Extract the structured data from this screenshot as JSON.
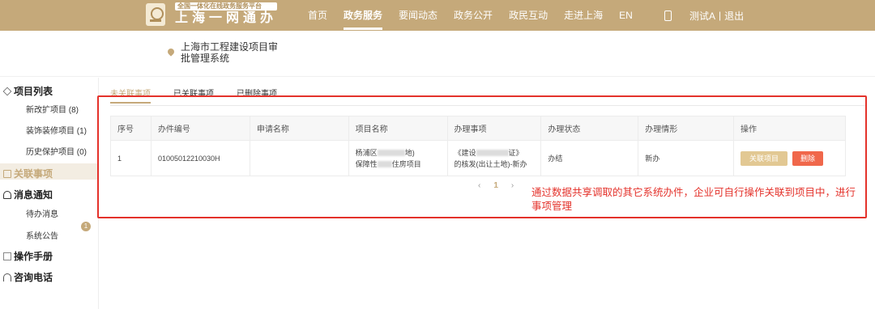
{
  "header": {
    "logo_tag": "全国一体化在线政务服务平台",
    "logo_title": "上海一网通办",
    "nav": [
      "首页",
      "政务服务",
      "要闻动态",
      "政务公开",
      "政民互动",
      "走进上海",
      "EN"
    ],
    "active_nav": "政务服务",
    "user": "测试A",
    "logout": "退出",
    "sep": "|"
  },
  "subheader": {
    "system_title": "上海市工程建设项目审批管理系统"
  },
  "sidebar": {
    "project_list": "项目列表",
    "items": [
      "新改扩项目 (8)",
      "装饰装修项目 (1)",
      "历史保护项目 (0)"
    ],
    "related": "关联事项",
    "messages": "消息通知",
    "msg_items": [
      "待办消息",
      "系统公告"
    ],
    "notice_badge": "1",
    "manual": "操作手册",
    "hotline": "咨询电话"
  },
  "tabs": [
    "未关联事项",
    "已关联事项",
    "已删除事项"
  ],
  "table": {
    "headers": [
      "序号",
      "办件编号",
      "申请名称",
      "项目名称",
      "办理事项",
      "办理状态",
      "办理情形",
      "操作"
    ],
    "rows": [
      {
        "index": "1",
        "case_no": "01005012210030H",
        "apply_name": "",
        "project_line1_a": "杨浦区",
        "project_line1_b": "地)",
        "project_line2_a": "保障性",
        "project_line2_b": "住房项目",
        "matter_line1_a": "《建设",
        "matter_line1_b": "证》",
        "matter_line2": "的核发(出让土地)-新办",
        "status": "办结",
        "situation": "新办",
        "btn_link": "关联项目",
        "btn_delete": "删除"
      }
    ]
  },
  "pager": {
    "prev": "‹",
    "current": "1",
    "next": "›"
  },
  "annotation": "通过数据共享调取的其它系统办件，企业可自行操作关联到项目中，进行事项管理",
  "colors": {
    "brand": "#c5a97a",
    "highlight": "#e4322b"
  }
}
